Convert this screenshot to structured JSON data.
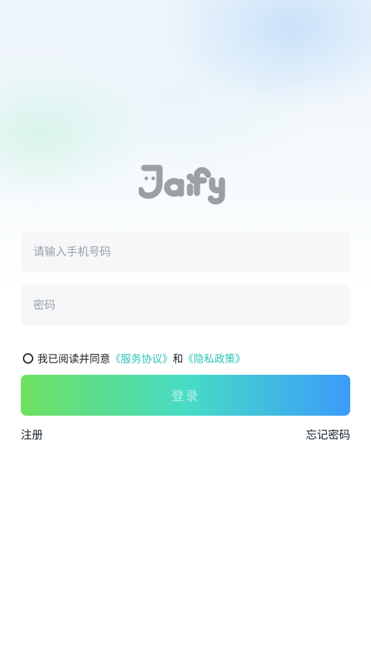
{
  "brand": {
    "logo_text": "Jaify",
    "logo_color": "#9aa0a6"
  },
  "form": {
    "phone_placeholder": "请输入手机号码",
    "phone_value": "",
    "password_placeholder": "密码",
    "password_value": ""
  },
  "agreement": {
    "checked": false,
    "prefix": "我已阅读并同意",
    "service_link": "《服务协议》",
    "conjunction": "和",
    "privacy_link": "《隐私政策》"
  },
  "actions": {
    "login_label": "登录",
    "register_label": "注册",
    "forgot_label": "忘记密码"
  },
  "colors": {
    "link": "#2bc4b9",
    "button_gradient_start": "#6fe05f",
    "button_gradient_mid": "#47dcc6",
    "button_gradient_end": "#3b9cf9",
    "field_bg": "#f6f7f8"
  }
}
